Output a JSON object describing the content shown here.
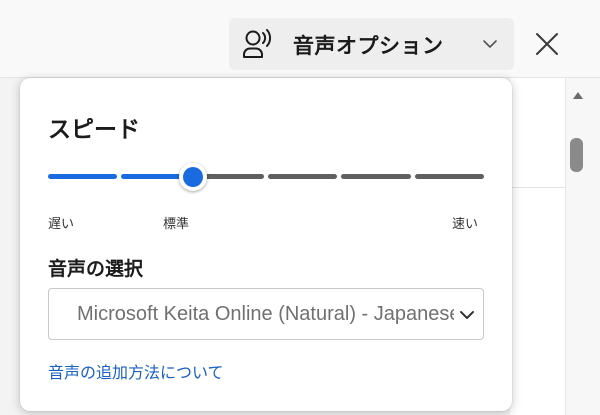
{
  "toolbar": {
    "voice_options_label": "音声オプション",
    "voice_icon": "voice-speaker-icon",
    "dropdown_icon": "chevron-down-icon",
    "close_icon": "close-icon"
  },
  "popup": {
    "speed_title": "スピード",
    "speed_slider": {
      "steps": 7,
      "selected_index": 2,
      "labels": {
        "slow": "遅い",
        "normal": "標準",
        "fast": "速い"
      }
    },
    "voice_section_title": "音声の選択",
    "voice_select": {
      "value": "Microsoft Keita Online (Natural) - Japanese (Japan)"
    },
    "add_voice_link": "音声の追加方法について"
  },
  "colors": {
    "accent": "#1a6be0",
    "link": "#1a5fc4",
    "track_inactive": "#5f5f5f"
  }
}
